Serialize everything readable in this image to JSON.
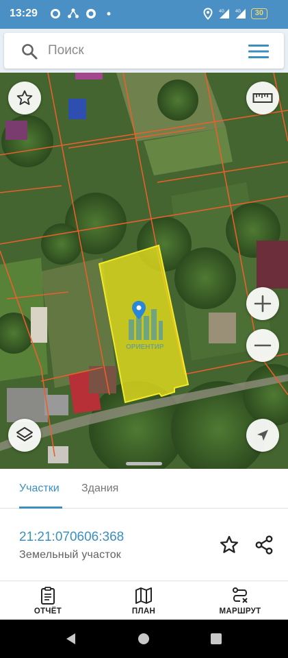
{
  "status_bar": {
    "time": "13:29",
    "left_icons": [
      "whatsapp-icon",
      "network-icon",
      "sync-icon",
      "dot-icon"
    ],
    "right_icons": [
      "location-icon",
      "signal-4g-icon",
      "signal-4g-icon"
    ],
    "battery": "30",
    "net_label_1": "4G",
    "net_label_2": "4G"
  },
  "search": {
    "placeholder": "Поиск",
    "search_icon": "search-icon",
    "menu_icon": "menu-icon"
  },
  "map": {
    "controls": {
      "favorite": "star-icon",
      "ruler": "ruler-icon",
      "zoom_in": "plus-icon",
      "zoom_out": "minus-icon",
      "layers": "layers-icon",
      "locate": "navigation-icon"
    },
    "parcel_color": "#e8e01e",
    "boundary_color": "#e8602c",
    "watermark_text": "ОРИЕНТИР"
  },
  "tabs": [
    {
      "label": "Участки",
      "active": true
    },
    {
      "label": "Здания",
      "active": false
    }
  ],
  "parcel": {
    "cadastral_number": "21:21:070606:368",
    "type": "Земельный участок"
  },
  "bottom_nav": [
    {
      "label": "ОТЧЁТ",
      "icon": "report-icon"
    },
    {
      "label": "ПЛАН",
      "icon": "map-icon"
    },
    {
      "label": "МАРШРУТ",
      "icon": "route-icon"
    }
  ],
  "colors": {
    "accent": "#3a8fc0",
    "status_bar": "#4a90c4"
  }
}
